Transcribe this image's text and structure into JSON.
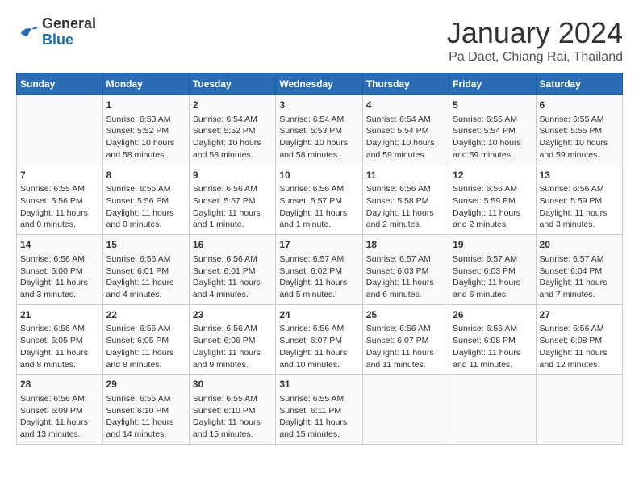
{
  "header": {
    "logo_general": "General",
    "logo_blue": "Blue",
    "month_title": "January 2024",
    "location": "Pa Daet, Chiang Rai, Thailand"
  },
  "columns": [
    "Sunday",
    "Monday",
    "Tuesday",
    "Wednesday",
    "Thursday",
    "Friday",
    "Saturday"
  ],
  "weeks": [
    [
      {
        "day": "",
        "info": ""
      },
      {
        "day": "1",
        "info": "Sunrise: 6:53 AM\nSunset: 5:52 PM\nDaylight: 10 hours\nand 58 minutes."
      },
      {
        "day": "2",
        "info": "Sunrise: 6:54 AM\nSunset: 5:52 PM\nDaylight: 10 hours\nand 58 minutes."
      },
      {
        "day": "3",
        "info": "Sunrise: 6:54 AM\nSunset: 5:53 PM\nDaylight: 10 hours\nand 58 minutes."
      },
      {
        "day": "4",
        "info": "Sunrise: 6:54 AM\nSunset: 5:54 PM\nDaylight: 10 hours\nand 59 minutes."
      },
      {
        "day": "5",
        "info": "Sunrise: 6:55 AM\nSunset: 5:54 PM\nDaylight: 10 hours\nand 59 minutes."
      },
      {
        "day": "6",
        "info": "Sunrise: 6:55 AM\nSunset: 5:55 PM\nDaylight: 10 hours\nand 59 minutes."
      }
    ],
    [
      {
        "day": "7",
        "info": "Sunrise: 6:55 AM\nSunset: 5:56 PM\nDaylight: 11 hours\nand 0 minutes."
      },
      {
        "day": "8",
        "info": "Sunrise: 6:55 AM\nSunset: 5:56 PM\nDaylight: 11 hours\nand 0 minutes."
      },
      {
        "day": "9",
        "info": "Sunrise: 6:56 AM\nSunset: 5:57 PM\nDaylight: 11 hours\nand 1 minute."
      },
      {
        "day": "10",
        "info": "Sunrise: 6:56 AM\nSunset: 5:57 PM\nDaylight: 11 hours\nand 1 minute."
      },
      {
        "day": "11",
        "info": "Sunrise: 6:56 AM\nSunset: 5:58 PM\nDaylight: 11 hours\nand 2 minutes."
      },
      {
        "day": "12",
        "info": "Sunrise: 6:56 AM\nSunset: 5:59 PM\nDaylight: 11 hours\nand 2 minutes."
      },
      {
        "day": "13",
        "info": "Sunrise: 6:56 AM\nSunset: 5:59 PM\nDaylight: 11 hours\nand 3 minutes."
      }
    ],
    [
      {
        "day": "14",
        "info": "Sunrise: 6:56 AM\nSunset: 6:00 PM\nDaylight: 11 hours\nand 3 minutes."
      },
      {
        "day": "15",
        "info": "Sunrise: 6:56 AM\nSunset: 6:01 PM\nDaylight: 11 hours\nand 4 minutes."
      },
      {
        "day": "16",
        "info": "Sunrise: 6:56 AM\nSunset: 6:01 PM\nDaylight: 11 hours\nand 4 minutes."
      },
      {
        "day": "17",
        "info": "Sunrise: 6:57 AM\nSunset: 6:02 PM\nDaylight: 11 hours\nand 5 minutes."
      },
      {
        "day": "18",
        "info": "Sunrise: 6:57 AM\nSunset: 6:03 PM\nDaylight: 11 hours\nand 6 minutes."
      },
      {
        "day": "19",
        "info": "Sunrise: 6:57 AM\nSunset: 6:03 PM\nDaylight: 11 hours\nand 6 minutes."
      },
      {
        "day": "20",
        "info": "Sunrise: 6:57 AM\nSunset: 6:04 PM\nDaylight: 11 hours\nand 7 minutes."
      }
    ],
    [
      {
        "day": "21",
        "info": "Sunrise: 6:56 AM\nSunset: 6:05 PM\nDaylight: 11 hours\nand 8 minutes."
      },
      {
        "day": "22",
        "info": "Sunrise: 6:56 AM\nSunset: 6:05 PM\nDaylight: 11 hours\nand 8 minutes."
      },
      {
        "day": "23",
        "info": "Sunrise: 6:56 AM\nSunset: 6:06 PM\nDaylight: 11 hours\nand 9 minutes."
      },
      {
        "day": "24",
        "info": "Sunrise: 6:56 AM\nSunset: 6:07 PM\nDaylight: 11 hours\nand 10 minutes."
      },
      {
        "day": "25",
        "info": "Sunrise: 6:56 AM\nSunset: 6:07 PM\nDaylight: 11 hours\nand 11 minutes."
      },
      {
        "day": "26",
        "info": "Sunrise: 6:56 AM\nSunset: 6:08 PM\nDaylight: 11 hours\nand 11 minutes."
      },
      {
        "day": "27",
        "info": "Sunrise: 6:56 AM\nSunset: 6:08 PM\nDaylight: 11 hours\nand 12 minutes."
      }
    ],
    [
      {
        "day": "28",
        "info": "Sunrise: 6:56 AM\nSunset: 6:09 PM\nDaylight: 11 hours\nand 13 minutes."
      },
      {
        "day": "29",
        "info": "Sunrise: 6:55 AM\nSunset: 6:10 PM\nDaylight: 11 hours\nand 14 minutes."
      },
      {
        "day": "30",
        "info": "Sunrise: 6:55 AM\nSunset: 6:10 PM\nDaylight: 11 hours\nand 15 minutes."
      },
      {
        "day": "31",
        "info": "Sunrise: 6:55 AM\nSunset: 6:11 PM\nDaylight: 11 hours\nand 15 minutes."
      },
      {
        "day": "",
        "info": ""
      },
      {
        "day": "",
        "info": ""
      },
      {
        "day": "",
        "info": ""
      }
    ]
  ]
}
